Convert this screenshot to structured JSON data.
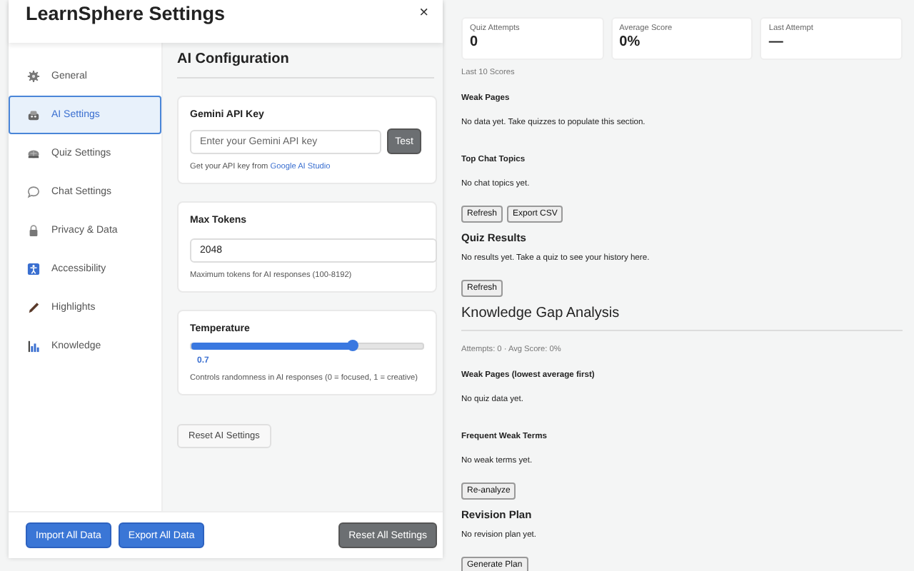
{
  "settings": {
    "title": "LearnSphere Settings",
    "close": "×",
    "nav": [
      {
        "label": "General",
        "selected": false
      },
      {
        "label": "AI Settings",
        "selected": true
      },
      {
        "label": "Quiz Settings",
        "selected": false
      },
      {
        "label": "Chat Settings",
        "selected": false
      },
      {
        "label": "Privacy & Data",
        "selected": false
      },
      {
        "label": "Accessibility",
        "selected": false
      },
      {
        "label": "Highlights",
        "selected": false
      },
      {
        "label": "Knowledge",
        "selected": false
      }
    ],
    "section_title": "AI Configuration",
    "api_key": {
      "label": "Gemini API Key",
      "placeholder": "Enter your Gemini API key",
      "button": "Test",
      "hint": "Get your API key from",
      "link": "Google AI Studio"
    },
    "max_tokens": {
      "label": "Max Tokens",
      "value": "2048",
      "hint": "Maximum tokens for AI responses (100-8192)"
    },
    "temperature": {
      "label": "Temperature",
      "level": 0.7,
      "reading": "0.7",
      "hint": "Controls randomness in AI responses (0 = focused, 1 = creative)"
    },
    "reset_button": "Reset AI Settings",
    "footer_buttons": [
      {
        "label": "Import All Data",
        "kind": "primary"
      },
      {
        "label": "Export All Data",
        "kind": "primary"
      },
      {
        "label": "Reset All Settings",
        "kind": "secondary"
      }
    ]
  },
  "dashboard": {
    "stats": [
      {
        "label": "Quiz Attempts",
        "value": "0"
      },
      {
        "label": "Average Score",
        "value": "0%"
      },
      {
        "label": "Last Attempt",
        "value": "—"
      }
    ],
    "blocks": [
      {
        "kind": "caption",
        "text": "Last 10 Scores"
      },
      {
        "kind": "subheading",
        "text": "Weak Pages"
      },
      {
        "kind": "note",
        "text": "No data yet. Take quizzes to populate this section."
      },
      {
        "kind": "subheading",
        "text": "Top Chat Topics"
      },
      {
        "kind": "note",
        "text": "No chat topics yet."
      },
      {
        "kind": "buttons",
        "buttons": [
          "Refresh",
          "Export CSV"
        ]
      },
      {
        "kind": "heading",
        "text": "Quiz Results"
      },
      {
        "kind": "note",
        "text": "No results yet. Take a quiz to see your history here."
      },
      {
        "kind": "buttons",
        "buttons": [
          "Refresh"
        ]
      },
      {
        "kind": "title",
        "text": "Knowledge Gap Analysis"
      },
      {
        "kind": "caption",
        "text": "Attempts: 0 · Avg Score: 0%"
      },
      {
        "kind": "subheading",
        "text": "Weak Pages (lowest average first)"
      },
      {
        "kind": "note",
        "text": "No quiz data yet."
      },
      {
        "kind": "subheading",
        "text": "Frequent Weak Terms"
      },
      {
        "kind": "note",
        "text": "No weak terms yet."
      },
      {
        "kind": "buttons",
        "buttons": [
          "Re-analyze"
        ]
      },
      {
        "kind": "heading",
        "text": "Revision Plan"
      },
      {
        "kind": "note",
        "text": "No revision plan yet."
      },
      {
        "kind": "buttons",
        "buttons": [
          "Generate Plan"
        ]
      }
    ]
  }
}
